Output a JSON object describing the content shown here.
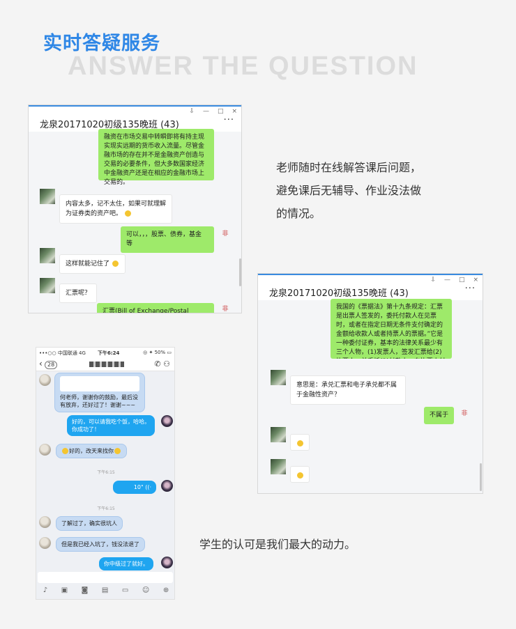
{
  "heading": {
    "title_cn": "实时答疑服务",
    "title_en": "ANSWER THE QUESTION"
  },
  "window1": {
    "title": "龙泉20171020初级135晚班 (43)",
    "controls": [
      "⇩",
      "—",
      "□",
      "×"
    ],
    "more": "···",
    "msg1": "融资在市场交易中转瞬即将有持主现实现实远期的货币收入流量。尽管金融市场的存在并不是金融资产创造与交易的必要条件，但大多数国家经济中金融资产还是在相应的金融市场上交易的。",
    "msg2": "内容太多，记不太住，如果可就理解为证券类的资产吧。",
    "msg3": "可以，，，股票、债券，基金 等",
    "msg4": "这样就能记住了",
    "msg5": "汇票呢？",
    "msg6": "汇票(Bill of Exchange/Postal Order/",
    "teacher_tag": "非"
  },
  "window2": {
    "title": "龙泉20171020初级135晚班 (43)",
    "controls": [
      "⇩",
      "—",
      "□",
      "×"
    ],
    "more": "···",
    "msg1": "我国的《票据法》第十九条规定：汇票是出票人签发的，委托付款人在见票时，或者在指定日期无条件支付确定的金额给收款人或者持票人的票据。”它是一种委付证券，基本的法律关系最少有三个人物，(1)发票人，签发汇票给(2)执票人，并委托(3)付款人，向执票人付款。",
    "msg2": "意思是：承兑汇票和电子承兑都不属于金融性资产？",
    "msg3": "不属于",
    "teacher_tag": "非"
  },
  "description": {
    "line1": "老师随时在线解答课后问题，",
    "line2": "避免课后无辅导、作业没法做",
    "line3": "的情况。"
  },
  "caption": "学生的认可是我们最大的动力。",
  "phone": {
    "carrier": "•••○○ 中国联通  4G",
    "time": "下午6:24",
    "battery": "◎ ✦ 50% ▭",
    "back_count": "28",
    "msg1": "何老师，谢谢你的鼓励，最后没有放弃，还好过了！谢谢~~~",
    "msg2": "好的，可以请我吃个饭，哈哈。你成功了！",
    "msg3": "好的，改天来找你",
    "time1": "下午6:15",
    "msg4": "10\" ((·",
    "time2": "下午6:15",
    "msg5": "了解过了，确实很坑人",
    "msg6": "但是我已经入坑了，钱没法退了",
    "msg7": "你中级过了就好。"
  }
}
